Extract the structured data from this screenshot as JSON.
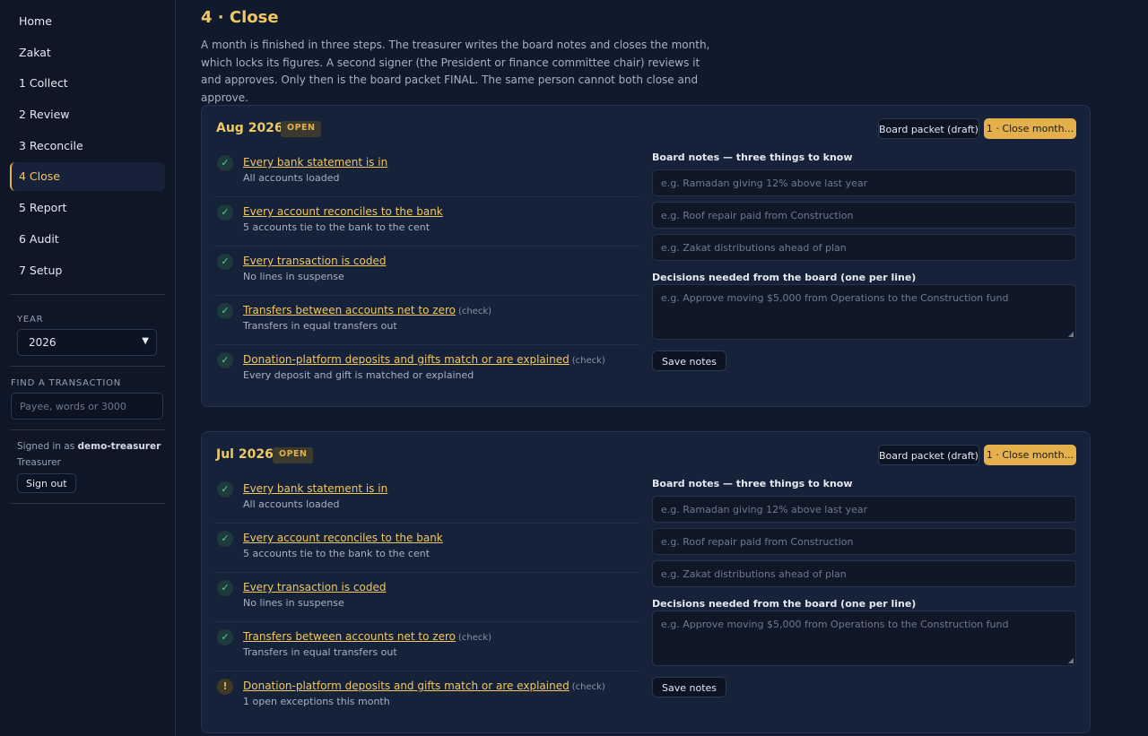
{
  "sidebar": {
    "nav": [
      "Home",
      "Zakat",
      "1 Collect",
      "2 Review",
      "3 Reconcile",
      "4 Close",
      "5 Report",
      "6 Audit",
      "7 Setup"
    ],
    "active_index": 5,
    "year_label": "YEAR",
    "year_value": "2026",
    "find_label": "FIND A TRANSACTION",
    "find_placeholder": "Payee, words or 3000",
    "signed_in_prefix": "Signed in as",
    "user": "demo-treasurer",
    "role": "Treasurer",
    "sign_out": "Sign out"
  },
  "page": {
    "title": "4 · Close",
    "intro": "A month is finished in three steps. The treasurer writes the board notes and closes the month, which locks its figures. A second signer (the President or finance committee chair) reviews it and approves. Only then is the board packet FINAL. The same person cannot both close and approve."
  },
  "months": [
    {
      "title": "Aug 2026",
      "badge": "OPEN",
      "draft_button": "Board packet (draft)",
      "close_button": "1 · Close month...",
      "checks": [
        {
          "status": "ok",
          "glyph": "✓",
          "title": "Every bank statement is in",
          "note": "",
          "sub": "All accounts loaded"
        },
        {
          "status": "ok",
          "glyph": "✓",
          "title": "Every account reconciles to the bank",
          "note": "",
          "sub": "5 accounts tie to the bank to the cent"
        },
        {
          "status": "ok",
          "glyph": "✓",
          "title": "Every transaction is coded",
          "note": "",
          "sub": "No lines in suspense"
        },
        {
          "status": "ok",
          "glyph": "✓",
          "title": "Transfers between accounts net to zero",
          "note": "(check)",
          "sub": "Transfers in equal transfers out"
        },
        {
          "status": "ok",
          "glyph": "✓",
          "title": "Donation-platform deposits and gifts match or are explained",
          "note": "(check)",
          "sub": "Every deposit and gift is matched or explained"
        }
      ],
      "notes_label": "Board notes — three things to know",
      "notes_placeholders": [
        "e.g. Ramadan giving 12% above last year",
        "e.g. Roof repair paid from Construction",
        "e.g. Zakat distributions ahead of plan"
      ],
      "decisions_label": "Decisions needed from the board (one per line)",
      "decisions_placeholder": "e.g. Approve moving $5,000 from Operations to the Construction fund",
      "save_button": "Save notes"
    },
    {
      "title": "Jul 2026",
      "badge": "OPEN",
      "draft_button": "Board packet (draft)",
      "close_button": "1 · Close month...",
      "checks": [
        {
          "status": "ok",
          "glyph": "✓",
          "title": "Every bank statement is in",
          "note": "",
          "sub": "All accounts loaded"
        },
        {
          "status": "ok",
          "glyph": "✓",
          "title": "Every account reconciles to the bank",
          "note": "",
          "sub": "5 accounts tie to the bank to the cent"
        },
        {
          "status": "ok",
          "glyph": "✓",
          "title": "Every transaction is coded",
          "note": "",
          "sub": "No lines in suspense"
        },
        {
          "status": "ok",
          "glyph": "✓",
          "title": "Transfers between accounts net to zero",
          "note": "(check)",
          "sub": "Transfers in equal transfers out"
        },
        {
          "status": "warn",
          "glyph": "!",
          "title": "Donation-platform deposits and gifts match or are explained",
          "note": "(check)",
          "sub": "1 open exceptions this month"
        }
      ],
      "notes_label": "Board notes — three things to know",
      "notes_placeholders": [
        "e.g. Ramadan giving 12% above last year",
        "e.g. Roof repair paid from Construction",
        "e.g. Zakat distributions ahead of plan"
      ],
      "decisions_label": "Decisions needed from the board (one per line)",
      "decisions_placeholder": "e.g. Approve moving $5,000 from Operations to the Construction fund",
      "save_button": "Save notes"
    }
  ]
}
